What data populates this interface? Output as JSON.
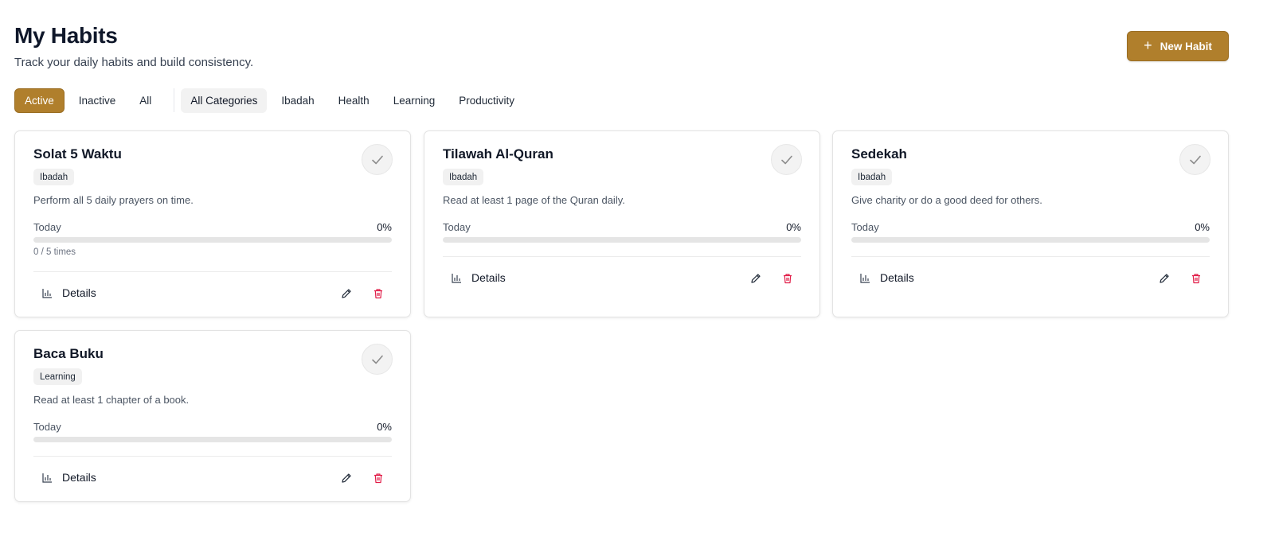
{
  "header": {
    "title": "My Habits",
    "subtitle": "Track your daily habits and build consistency.",
    "new_button_label": "New Habit"
  },
  "filters": {
    "status": [
      {
        "label": "Active",
        "selected": true
      },
      {
        "label": "Inactive",
        "selected": false
      },
      {
        "label": "All",
        "selected": false
      }
    ],
    "categories": [
      {
        "label": "All Categories",
        "selected": true
      },
      {
        "label": "Ibadah",
        "selected": false
      },
      {
        "label": "Health",
        "selected": false
      },
      {
        "label": "Learning",
        "selected": false
      },
      {
        "label": "Productivity",
        "selected": false
      }
    ]
  },
  "habits": [
    {
      "title": "Solat 5 Waktu",
      "category": "Ibadah",
      "description": "Perform all 5 daily prayers on time.",
      "progress_label": "Today",
      "progress_pct": "0%",
      "progress_value": 0,
      "times": "0 / 5 times",
      "details_label": "Details"
    },
    {
      "title": "Tilawah Al-Quran",
      "category": "Ibadah",
      "description": "Read at least 1 page of the Quran daily.",
      "progress_label": "Today",
      "progress_pct": "0%",
      "progress_value": 0,
      "details_label": "Details"
    },
    {
      "title": "Sedekah",
      "category": "Ibadah",
      "description": "Give charity or do a good deed for others.",
      "progress_label": "Today",
      "progress_pct": "0%",
      "progress_value": 0,
      "details_label": "Details"
    },
    {
      "title": "Baca Buku",
      "category": "Learning",
      "description": "Read at least 1 chapter of a book.",
      "progress_label": "Today",
      "progress_pct": "0%",
      "progress_value": 0,
      "details_label": "Details"
    }
  ],
  "colors": {
    "accent": "#b07f2c",
    "delete": "#e11d48",
    "track": "#e5e5e5"
  },
  "icons": {
    "new": "plus-icon",
    "complete": "check-icon",
    "details": "bar-chart-icon",
    "edit": "pencil-icon",
    "delete": "trash-icon"
  }
}
